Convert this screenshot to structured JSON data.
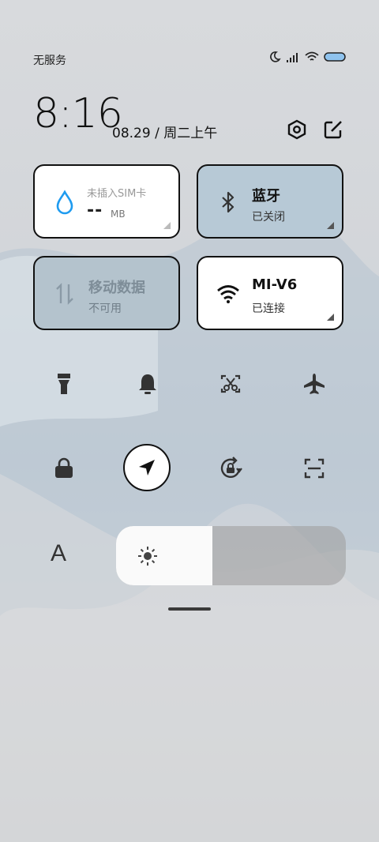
{
  "status_bar": {
    "carrier": "无服务",
    "icons": [
      "moon-icon",
      "signal-icon",
      "wifi-icon",
      "battery-icon"
    ]
  },
  "header": {
    "time": "8:16",
    "date": "08.29 / 周二上午",
    "icons": [
      "settings-icon",
      "edit-icon"
    ]
  },
  "tiles": {
    "sim": {
      "title": "未插入SIM卡",
      "value": "--",
      "unit": "MB",
      "icon": "water-drop-icon",
      "accent": "#1e9bf0"
    },
    "bluetooth": {
      "title": "蓝牙",
      "status": "已关闭",
      "icon": "bluetooth-icon"
    },
    "mobile_data": {
      "title": "移动数据",
      "status": "不可用",
      "icon": "data-arrows-icon"
    },
    "wifi": {
      "title": "MI-V6",
      "status": "已连接",
      "icon": "wifi-icon"
    }
  },
  "toggles_row1": [
    "flashlight-icon",
    "bell-icon",
    "screenshot-icon",
    "airplane-icon"
  ],
  "toggles_row2": [
    "lock-icon",
    "location-icon",
    "rotation-lock-icon",
    "scan-icon"
  ],
  "font_size_label": "A",
  "brightness": {
    "level": 0.42,
    "icon": "sun-icon"
  }
}
